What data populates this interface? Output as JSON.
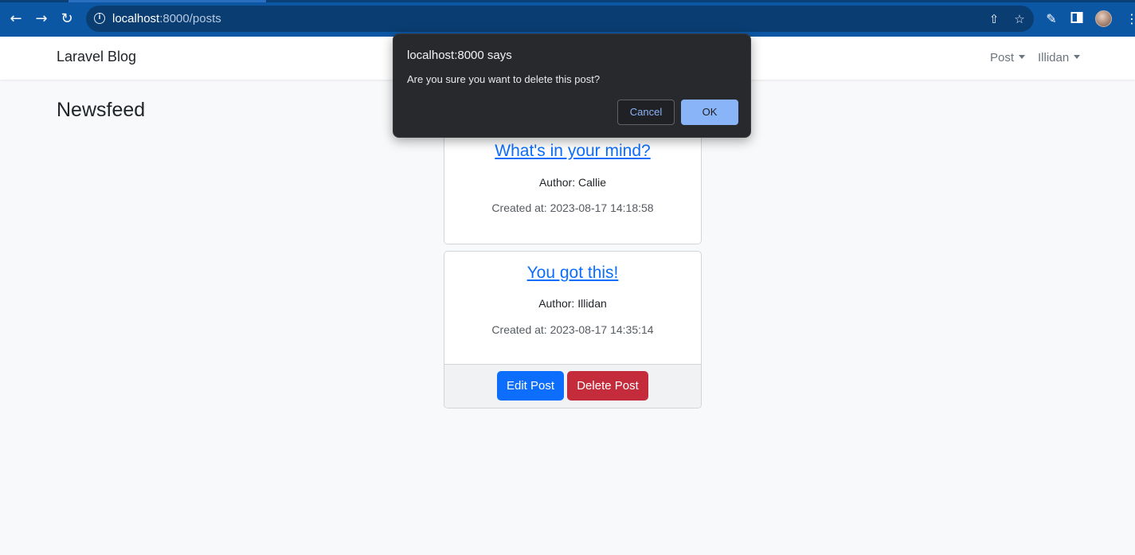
{
  "browser": {
    "url_host": "localhost",
    "url_path": ":8000/posts",
    "icons": [
      "back-arrow-icon",
      "forward-arrow-icon",
      "reload-icon",
      "info-icon",
      "share-icon",
      "star-icon",
      "extensions-icon",
      "sidebar-icon",
      "profile-avatar",
      "menu-icon"
    ]
  },
  "navbar": {
    "brand": "Laravel Blog",
    "post_menu": "Post",
    "user_menu": "Illidan"
  },
  "page": {
    "title": "Newsfeed"
  },
  "posts": [
    {
      "title": "What's in your mind?",
      "author": "Author: Callie",
      "created": "Created at: 2023-08-17 14:18:58"
    },
    {
      "title": "You got this!",
      "author": "Author: Illidan",
      "created": "Created at: 2023-08-17 14:35:14",
      "edit_label": "Edit Post",
      "delete_label": "Delete Post"
    }
  ],
  "dialog": {
    "title": "localhost:8000 says",
    "message": "Are you sure you want to delete this post?",
    "cancel_label": "Cancel",
    "ok_label": "OK"
  },
  "colors": {
    "chrome": "#0b57a4",
    "primary": "#0d6efd",
    "danger": "#c42c3c",
    "dialog_bg": "#28292c",
    "dialog_accent": "#8ab4f8"
  }
}
